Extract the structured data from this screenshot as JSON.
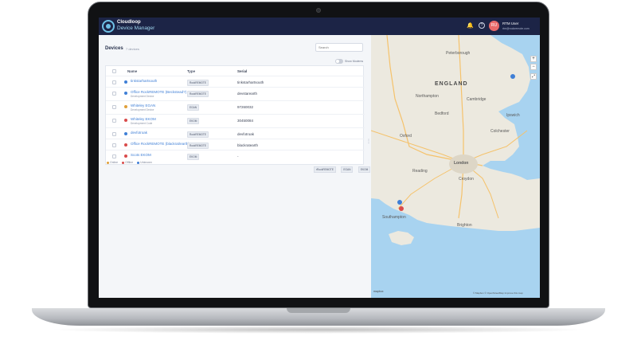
{
  "app": {
    "brand_line1": "Cloudloop",
    "brand_line2": "Device Manager",
    "user_initials": "RU",
    "user_name": "RTM User",
    "user_email": "rtm@rockremote.com"
  },
  "devices": {
    "title": "Devices",
    "count": "7 devices",
    "search_placeholder": "Search",
    "toggle_label": "Show Modems",
    "columns": {
      "name": "Name",
      "type": "Type",
      "serial": "Serial"
    },
    "rows": [
      {
        "name": "tinkstarhartsouth",
        "sub": "",
        "type": "RockREMOTE",
        "serial": "tinkstarhartsouth",
        "status_color": "#3f7fd6"
      },
      {
        "name": "Office RockREMOTE (Beckstead?)",
        "sub": "Development Device",
        "type": "RockREMOTE",
        "serial": "devstarearth",
        "status_color": "#3f7fd6"
      },
      {
        "name": "Whiteley EGAN",
        "sub": "Development Device",
        "type": "EGAN",
        "serial": "97260032",
        "status_color": "#e0a03a"
      },
      {
        "name": "Whiteley EKOM",
        "sub": "Development Code",
        "type": "EKOM",
        "serial": "30450084",
        "status_color": "#d94b4b"
      },
      {
        "name": "devfotroak",
        "sub": "",
        "type": "RockREMOTE",
        "serial": "devfotroak",
        "status_color": "#3f7fd6"
      },
      {
        "name": "Office RockREMOTE (blackrat/earth)",
        "sub": "",
        "type": "RockREMOTE",
        "serial": "blackratearth",
        "status_color": "#d94b4b"
      },
      {
        "name": "Scots EKOM",
        "sub": "",
        "type": "EKOM",
        "serial": "-",
        "status_color": "#d94b4b"
      }
    ],
    "legend": [
      {
        "label": "Online",
        "color": "#e0a03a"
      },
      {
        "label": "Offline",
        "color": "#d94b4b"
      },
      {
        "label": "Unknown",
        "color": "#3f7fd6"
      }
    ],
    "filters": [
      "rRockREMOTE",
      "EGAN",
      "EKOM"
    ]
  },
  "map": {
    "labels": {
      "england": "ENGLAND",
      "peterborough": "Peterborough",
      "northampton": "Northampton",
      "cambridge": "Cambridge",
      "bedford": "Bedford",
      "ipswich": "Ipswich",
      "colchester": "Colchester",
      "oxford": "Oxford",
      "london": "London",
      "croydon": "Croydon",
      "reading": "Reading",
      "southampton": "Southampton",
      "brighton": "Brighton"
    },
    "zoom_in": "+",
    "zoom_out": "−",
    "logo": "mapbox",
    "attribution": "© Mapbox © OpenStreetMap Improve this map"
  }
}
